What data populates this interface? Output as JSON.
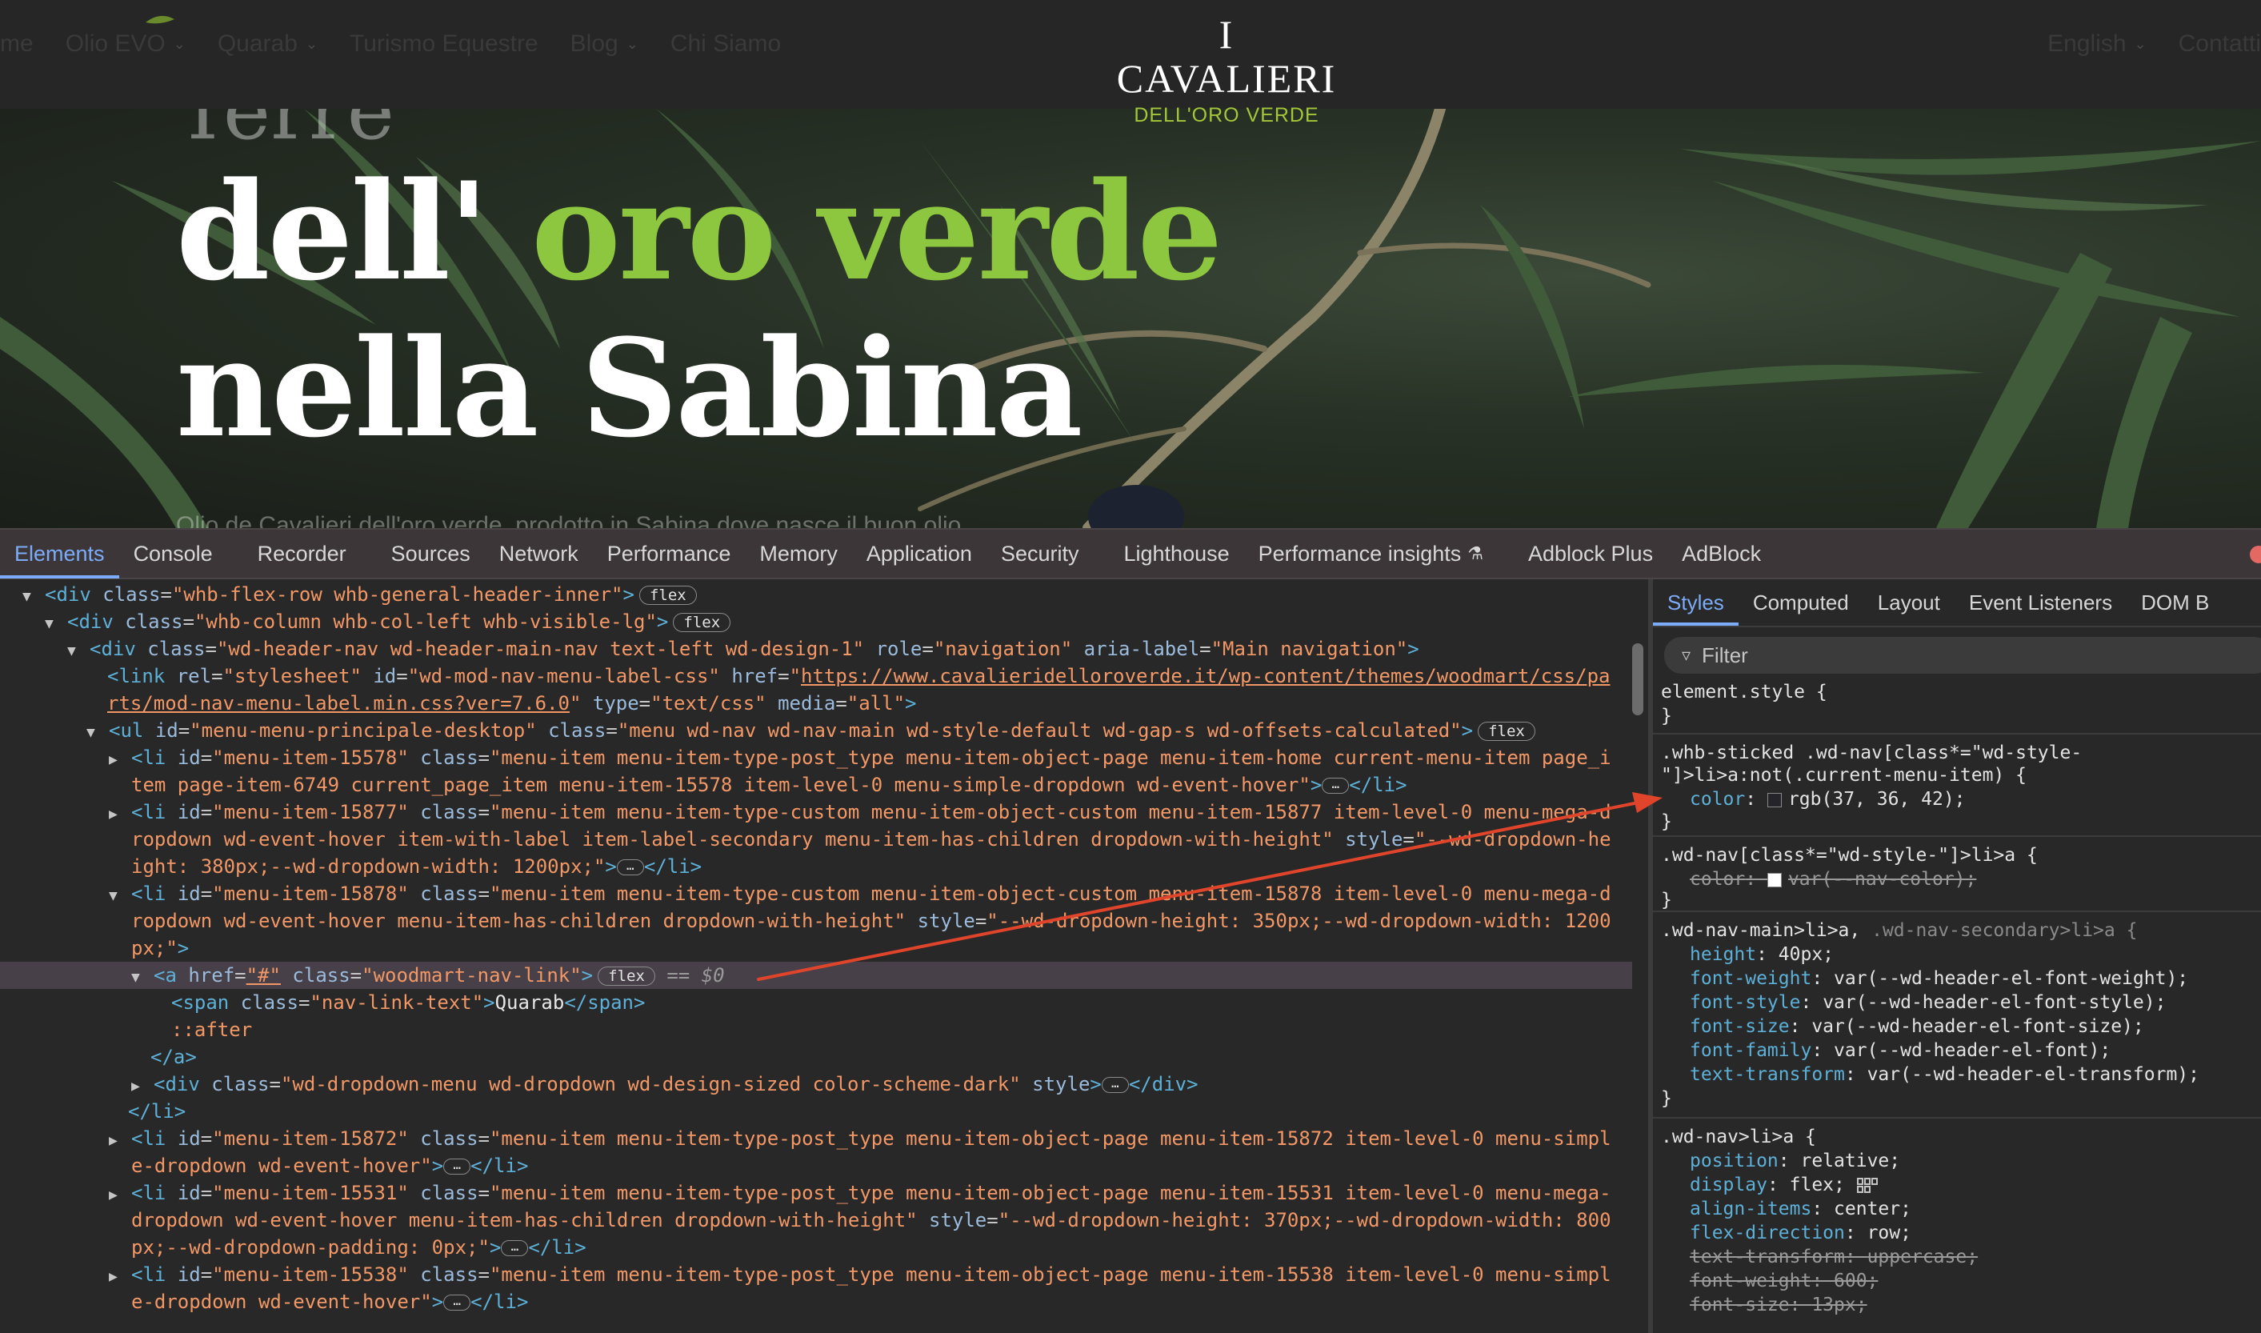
{
  "site": {
    "nav_left": [
      "me",
      "Olio EVO",
      "Quarab",
      "Turismo Equestre",
      "Blog",
      "Chi Siamo"
    ],
    "nav_left_dropdown": [
      false,
      true,
      true,
      false,
      true,
      false
    ],
    "nav_right": [
      "English",
      "Contatti"
    ],
    "logo_main": "I CAVALIERI",
    "logo_sub": "DELL'ORO VERDE",
    "hero_partial": "Terre",
    "hero_line1_a": "dell'",
    "hero_line1_b": "oro verde",
    "hero_line2": "nella Sabina",
    "hero_sub": "Olio de Cavalieri dell'oro verde, prodotto in Sabina dove nasce il buon olio",
    "accent_color": "#8dc63f"
  },
  "devtools": {
    "tabs": [
      "Elements",
      "Console",
      "Recorder",
      "Sources",
      "Network",
      "Performance",
      "Memory",
      "Application",
      "Security",
      "Lighthouse",
      "Performance insights",
      "Adblock Plus",
      "AdBlock"
    ],
    "active_tab": "Elements",
    "elements": {
      "l1": {
        "tag": "<div",
        "a1": "class",
        "v1": "\"whb-flex-row whb-general-header-inner\"",
        "close": ">",
        "badge": "flex"
      },
      "l2": {
        "tag": "<div",
        "a1": "class",
        "v1": "\"whb-column whb-col-left whb-visible-lg\"",
        "close": ">",
        "badge": "flex"
      },
      "l3": {
        "tag": "<div",
        "a1": "class",
        "v1": "\"wd-header-nav wd-header-main-nav text-left wd-design-1\"",
        "a2": "role",
        "v2": "\"navigation\"",
        "a3": "aria-label",
        "v3": "\"Main navigation\"",
        "close": ">"
      },
      "l4a": {
        "tag": "<link",
        "a1": "rel",
        "v1": "\"stylesheet\"",
        "a2": "id",
        "v2": "\"wd-mod-nav-menu-label-css\"",
        "a3": "href",
        "v3": "\"",
        "link1": "https://www.cavalieridelloroverde.it/wp-content/themes/woodmart/css/pa"
      },
      "l4b": {
        "link2": "rts/mod-nav-menu-label.min.css?ver=7.6.0",
        "q": "\"",
        "a4": "type",
        "v4": "\"text/css\"",
        "a5": "media",
        "v5": "\"all\"",
        "close": ">"
      },
      "l5": {
        "tag": "<ul",
        "a1": "id",
        "v1": "\"menu-menu-principale-desktop\"",
        "a2": "class",
        "v2": "\"menu wd-nav wd-nav-main wd-style-default wd-gap-s wd-offsets-calculated\"",
        "close": ">",
        "badge": "flex"
      },
      "l6a": {
        "tag": "<li",
        "a1": "id",
        "v1": "\"menu-item-15578\"",
        "a2": "class",
        "v2": "\"menu-item menu-item-type-post_type menu-item-object-page menu-item-home current-menu-item page_i"
      },
      "l6b": {
        "v": "tem page-item-6749 current_page_item menu-item-15578 item-level-0 menu-simple-dropdown wd-event-hover\"",
        "close": ">",
        "end": "</li>"
      },
      "l7a": {
        "tag": "<li",
        "a1": "id",
        "v1": "\"menu-item-15877\"",
        "a2": "class",
        "v2": "\"menu-item menu-item-type-custom menu-item-object-custom menu-item-15877 item-level-0 menu-mega-d"
      },
      "l7b": {
        "v": "ropdown wd-event-hover item-with-label item-label-secondary menu-item-has-children dropdown-with-height\"",
        "a3": "style",
        "v3": "\"--wd-dropdown-he"
      },
      "l7c": {
        "v": "ight: 380px;--wd-dropdown-width: 1200px;\"",
        "close": ">",
        "end": "</li>"
      },
      "l8a": {
        "tag": "<li",
        "a1": "id",
        "v1": "\"menu-item-15878\"",
        "a2": "class",
        "v2": "\"menu-item menu-item-type-custom menu-item-object-custom menu-item-15878 item-level-0 menu-mega-d"
      },
      "l8b": {
        "v": "ropdown wd-event-hover menu-item-has-children dropdown-with-height\"",
        "a3": "style",
        "v3": "\"--wd-dropdown-height: 350px;--wd-dropdown-width: 1200"
      },
      "l8c": {
        "v": "px;\"",
        "close": ">"
      },
      "l9": {
        "tag": "<a",
        "a1": "href",
        "v1": "\"#\"",
        "a2": "class",
        "v2": "\"woodmart-nav-link\"",
        "close": ">",
        "badge": "flex",
        "eq": "==",
        "sel": "$0"
      },
      "l10": {
        "tag": "<span",
        "a1": "class",
        "v1": "\"nav-link-text\"",
        "close": ">",
        "text": "Quarab",
        "end": "</span>"
      },
      "l11": {
        "pseudo": "::after"
      },
      "l12": {
        "end": "</a>"
      },
      "l13": {
        "tag": "<div",
        "a1": "class",
        "v1": "\"wd-dropdown-menu wd-dropdown wd-design-sized color-scheme-dark\"",
        "a2": "style",
        "close": ">",
        "end": "</div>"
      },
      "l14": {
        "end": "</li>"
      },
      "l15a": {
        "tag": "<li",
        "a1": "id",
        "v1": "\"menu-item-15872\"",
        "a2": "class",
        "v2": "\"menu-item menu-item-type-post_type menu-item-object-page menu-item-15872 item-level-0 menu-simpl"
      },
      "l15b": {
        "v": "e-dropdown wd-event-hover\"",
        "close": ">",
        "end": "</li>"
      },
      "l16a": {
        "tag": "<li",
        "a1": "id",
        "v1": "\"menu-item-15531\"",
        "a2": "class",
        "v2": "\"menu-item menu-item-type-post_type menu-item-object-page menu-item-15531 item-level-0 menu-mega-"
      },
      "l16b": {
        "v": "dropdown wd-event-hover menu-item-has-children dropdown-with-height\"",
        "a3": "style",
        "v3": "\"--wd-dropdown-height: 370px;--wd-dropdown-width: 800"
      },
      "l16c": {
        "v": "px;--wd-dropdown-padding: 0px;\"",
        "close": ">",
        "end": "</li>"
      },
      "l17a": {
        "tag": "<li",
        "a1": "id",
        "v1": "\"menu-item-15538\"",
        "a2": "class",
        "v2": "\"menu-item menu-item-type-post_type menu-item-object-page menu-item-15538 item-level-0 menu-simpl"
      },
      "l17b": {
        "v": "e-dropdown wd-event-hover\"",
        "close": ">",
        "end": "</li>"
      }
    },
    "styles": {
      "tabs": [
        "Styles",
        "Computed",
        "Layout",
        "Event Listeners",
        "DOM B"
      ],
      "active_tab": "Styles",
      "filter_placeholder": "Filter",
      "r1": {
        "sel": "element.style {",
        "close": "}"
      },
      "r2": {
        "sel1": ".whb-sticked .wd-nav[class*=\"wd-style-",
        "sel2": "\"]>li>a:not(.current-menu-item) {",
        "p1": "color",
        "v1": "rgb(37, 36, 42)",
        "swatch": "#25242a",
        "close": "}"
      },
      "r3": {
        "sel": ".wd-nav[class*=\"wd-style-\"]>li>a {",
        "p1": "color",
        "v1": "var(--nav-color)",
        "swatch": "#ffffff",
        "close": "}"
      },
      "r4": {
        "sel_a": ".wd-nav-main>li>a,",
        "sel_b": ".wd-nav-secondary>li>a {",
        "decls": [
          {
            "p": "height",
            "v": "40px;"
          },
          {
            "p": "font-weight",
            "v": "var(--wd-header-el-font-weight);"
          },
          {
            "p": "font-style",
            "v": "var(--wd-header-el-font-style);"
          },
          {
            "p": "font-size",
            "v": "var(--wd-header-el-font-size);"
          },
          {
            "p": "font-family",
            "v": "var(--wd-header-el-font);"
          },
          {
            "p": "text-transform",
            "v": "var(--wd-header-el-transform);"
          }
        ],
        "close": "}"
      },
      "r5": {
        "sel": ".wd-nav>li>a {",
        "decls": [
          {
            "p": "position",
            "v": "relative;",
            "strike": false
          },
          {
            "p": "display",
            "v": "flex;",
            "strike": false
          },
          {
            "p": "align-items",
            "v": "center;",
            "strike": false
          },
          {
            "p": "flex-direction",
            "v": "row;",
            "strike": false
          },
          {
            "p": "text-transform",
            "v": "uppercase;",
            "strike": true
          },
          {
            "p": "font-weight",
            "v": "600;",
            "strike": true
          },
          {
            "p": "font-size",
            "v": "13px;",
            "strike": true
          }
        ]
      }
    }
  },
  "colors": {
    "devtools_bg": "#282828",
    "tag": "#5db0d7",
    "attr_value": "#f29766",
    "active_tab": "#7cacf8",
    "arrow": "#e0452b"
  }
}
